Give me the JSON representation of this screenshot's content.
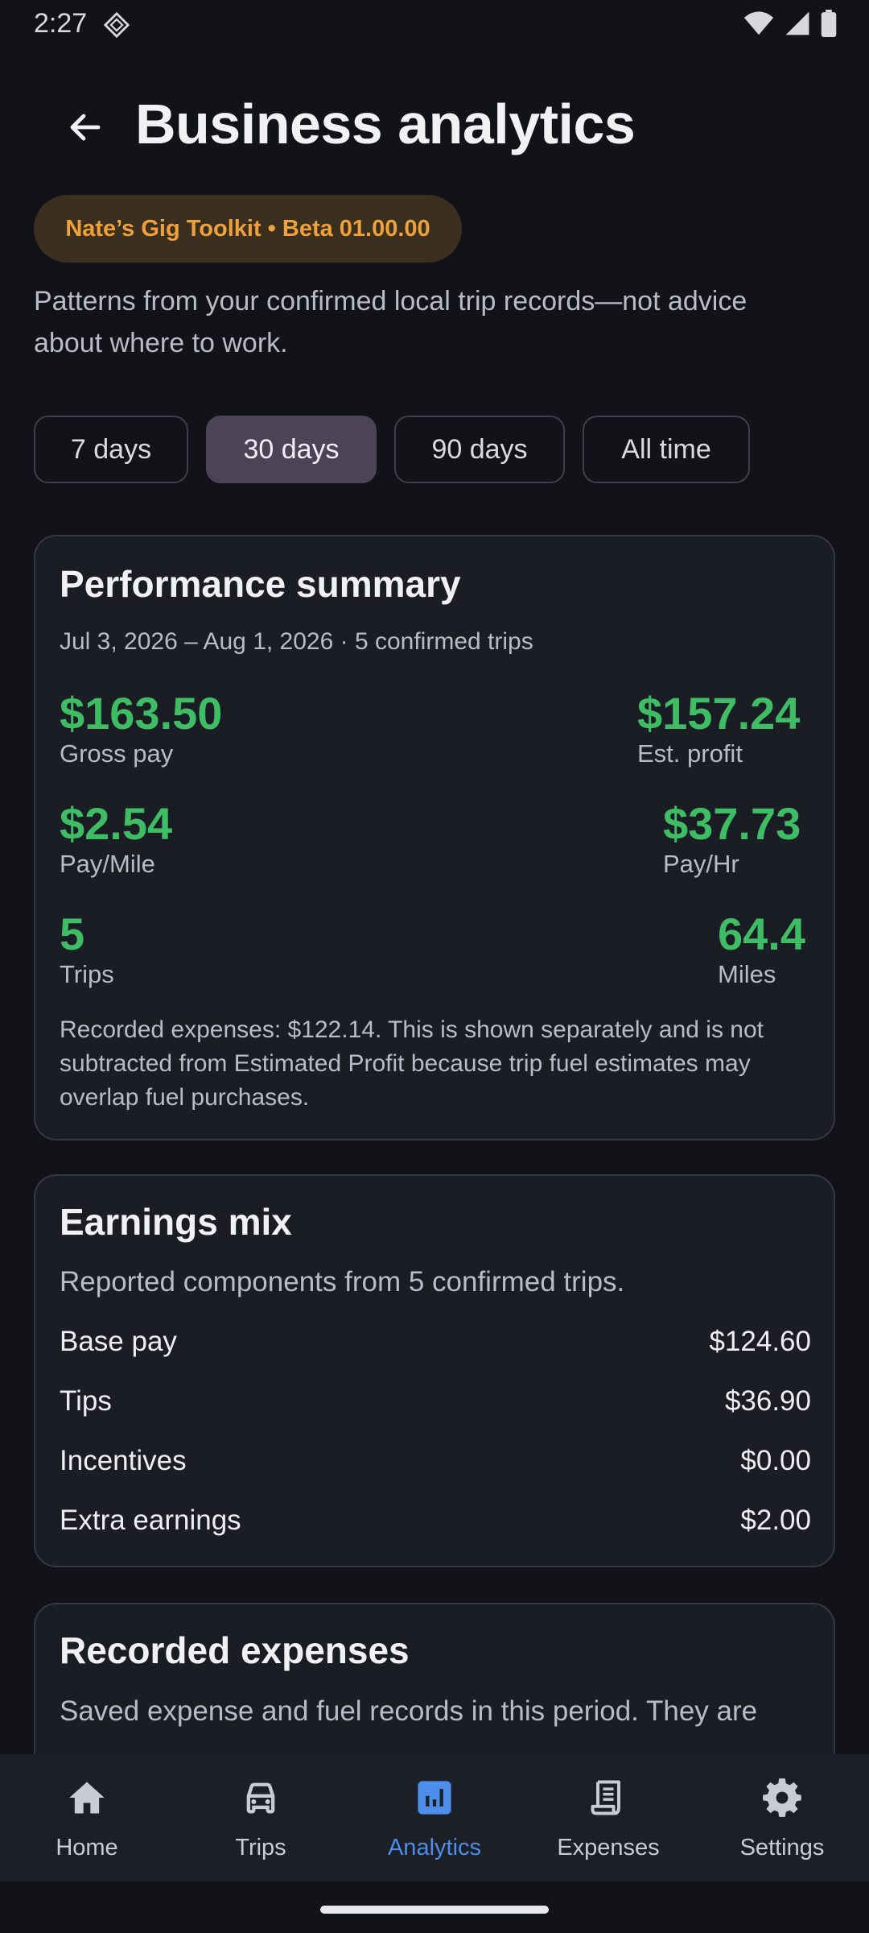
{
  "status_bar": {
    "time": "2:27"
  },
  "header": {
    "title": "Business analytics",
    "badge": "Nate’s Gig Toolkit • Beta 01.00.00",
    "intro": "Patterns from your confirmed local trip records—not advice about where to work."
  },
  "ranges": [
    {
      "label": "7 days",
      "selected": false
    },
    {
      "label": "30 days",
      "selected": true
    },
    {
      "label": "90 days",
      "selected": false
    },
    {
      "label": "All time",
      "selected": false
    }
  ],
  "performance": {
    "title": "Performance summary",
    "subtitle": "Jul 3, 2026 – Aug 1, 2026 · 5 confirmed trips",
    "metrics": [
      {
        "value": "$163.50",
        "label": "Gross pay"
      },
      {
        "value": "$157.24",
        "label": "Est. profit"
      },
      {
        "value": "$2.54",
        "label": "Pay/Mile"
      },
      {
        "value": "$37.73",
        "label": "Pay/Hr"
      },
      {
        "value": "5",
        "label": "Trips"
      },
      {
        "value": "64.4",
        "label": "Miles"
      }
    ],
    "note": "Recorded expenses: $122.14. This is shown separately and is not subtracted from Estimated Profit because trip fuel estimates may overlap fuel purchases."
  },
  "earnings_mix": {
    "title": "Earnings mix",
    "subtitle": "Reported components from 5 confirmed trips.",
    "rows": [
      {
        "label": "Base pay",
        "value": "$124.60"
      },
      {
        "label": "Tips",
        "value": "$36.90"
      },
      {
        "label": "Incentives",
        "value": "$0.00"
      },
      {
        "label": "Extra earnings",
        "value": "$2.00"
      }
    ]
  },
  "recorded_expenses": {
    "title": "Recorded expenses",
    "subtitle": "Saved expense and fuel records in this period. They are"
  },
  "nav": [
    {
      "label": "Home",
      "icon": "home-icon",
      "active": false
    },
    {
      "label": "Trips",
      "icon": "car-icon",
      "active": false
    },
    {
      "label": "Analytics",
      "icon": "analytics-icon",
      "active": true
    },
    {
      "label": "Expenses",
      "icon": "receipt-icon",
      "active": false
    },
    {
      "label": "Settings",
      "icon": "gear-icon",
      "active": false
    }
  ],
  "colors": {
    "background": "#111318",
    "accent_green": "#3fbd64",
    "badge_orange": "#f0a13a",
    "nav_active": "#4c8eea",
    "chip_selected": "#4a4456"
  }
}
